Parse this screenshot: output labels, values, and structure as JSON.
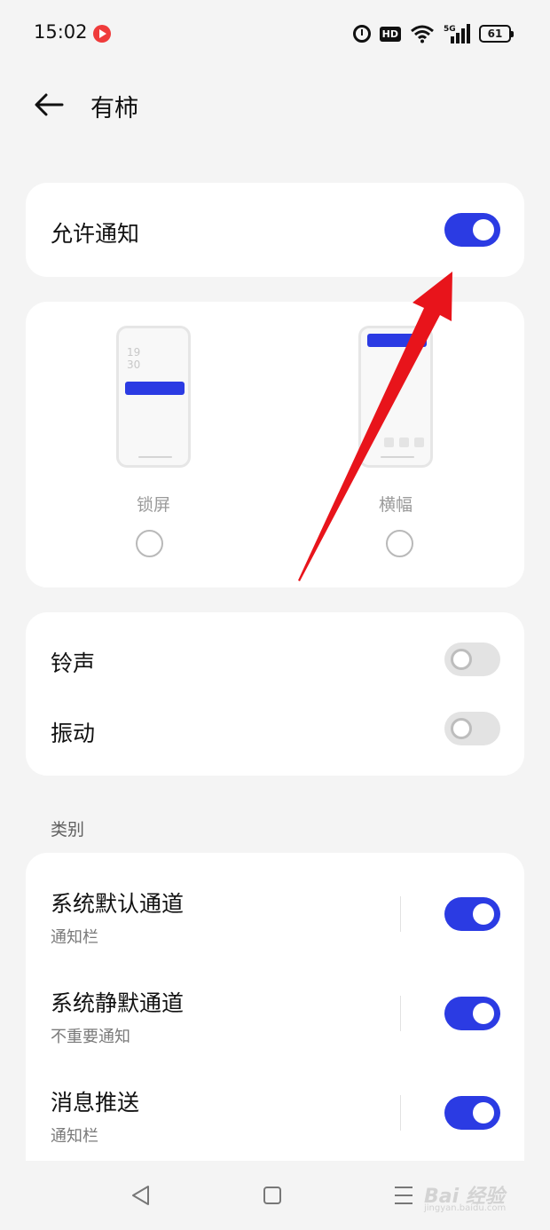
{
  "status_bar": {
    "time": "15:02",
    "icons": [
      "video-app-icon",
      "alarm-icon",
      "hd-icon",
      "wifi-icon",
      "5g-signal-icon",
      "battery-icon"
    ],
    "hd": "HD",
    "network": "5G",
    "battery": "61"
  },
  "header": {
    "title": "有柿",
    "back_icon": "arrow-left-icon"
  },
  "allow_notifications": {
    "label": "允许通知",
    "enabled": true
  },
  "notification_styles": [
    {
      "label": "锁屏",
      "selected": false,
      "clock": [
        "19",
        "30"
      ]
    },
    {
      "label": "横幅",
      "selected": false
    }
  ],
  "sound_settings": [
    {
      "label": "铃声",
      "enabled": false
    },
    {
      "label": "振动",
      "enabled": false
    }
  ],
  "categories": {
    "header": "类别",
    "items": [
      {
        "label": "系统默认通道",
        "sub": "通知栏",
        "enabled": true
      },
      {
        "label": "系统静默通道",
        "sub": "不重要通知",
        "enabled": true
      },
      {
        "label": "消息推送",
        "sub": "通知栏",
        "enabled": true
      }
    ]
  },
  "nav_bar": {
    "icons": [
      "back-triangle-icon",
      "home-square-icon",
      "menu-lines-icon"
    ]
  },
  "watermark": {
    "text": "Bai 经验",
    "sub": "jingyan.baidu.com"
  },
  "colors": {
    "accent": "#2b3be3",
    "annotation_arrow": "#e8141b",
    "background": "#f4f4f4"
  }
}
